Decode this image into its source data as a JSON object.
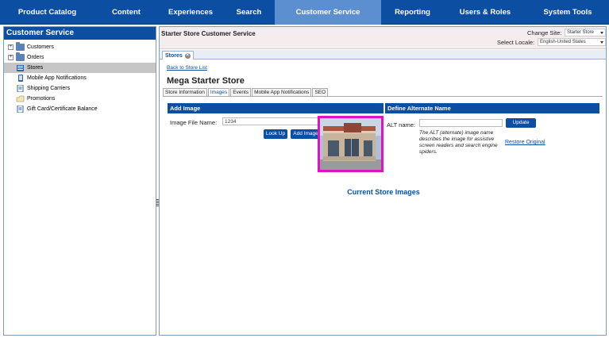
{
  "nav": {
    "items": [
      {
        "label": "Product Catalog",
        "active": false
      },
      {
        "label": "Content",
        "active": false
      },
      {
        "label": "Experiences",
        "active": false
      },
      {
        "label": "Search",
        "active": false
      },
      {
        "label": "Customer Service",
        "active": true
      },
      {
        "label": "Reporting",
        "active": false
      },
      {
        "label": "Users & Roles",
        "active": false
      },
      {
        "label": "System Tools",
        "active": false
      }
    ]
  },
  "sidebar": {
    "title": "Customer Service",
    "items": [
      {
        "label": "Customers",
        "icon": "folder-icon",
        "expandable": true,
        "selected": false
      },
      {
        "label": "Orders",
        "icon": "folder-icon",
        "expandable": true,
        "selected": false
      },
      {
        "label": "Stores",
        "icon": "store-icon",
        "expandable": false,
        "selected": true
      },
      {
        "label": "Mobile App Notifications",
        "icon": "mobile-icon",
        "expandable": false,
        "selected": false
      },
      {
        "label": "Shipping Carriers",
        "icon": "shipping-icon",
        "expandable": false,
        "selected": false
      },
      {
        "label": "Promotions",
        "icon": "promotion-icon",
        "expandable": false,
        "selected": false
      },
      {
        "label": "Gift Card/Certificate Balance",
        "icon": "gift-card-icon",
        "expandable": false,
        "selected": false
      }
    ]
  },
  "header": {
    "title": "Starter Store Customer Service",
    "change_site_label": "Change Site:",
    "change_site_value": "Starter Store",
    "locale_label": "Select Locale:",
    "locale_value": "English-United States"
  },
  "tab": {
    "label": "Stores"
  },
  "page": {
    "back_link": "Back to Store List",
    "store_name": "Mega Starter Store",
    "subtabs": [
      {
        "label": "Store Information",
        "active": false
      },
      {
        "label": "Images",
        "active": true
      },
      {
        "label": "Events",
        "active": false
      },
      {
        "label": "Mobile App Notifications",
        "active": false
      },
      {
        "label": "SEO",
        "active": false
      }
    ]
  },
  "add_image": {
    "title": "Add Image",
    "file_label": "Image File Name:",
    "file_value": "1234",
    "lookup_label": "Look Up",
    "add_label": "Add Image"
  },
  "alt_name": {
    "title": "Define Alternate Name",
    "label": "ALT name:",
    "value": "",
    "update_label": "Update",
    "description": "The ALT (alternate) image name describes the image for assistive screen readers and search engine spiders.",
    "restore_label": "Restore Original"
  },
  "current_images": {
    "title": "Current Store Images"
  },
  "colors": {
    "nav_bg": "#0b4ea2",
    "nav_active": "#5c8fd0",
    "highlight": "#e013c3"
  }
}
